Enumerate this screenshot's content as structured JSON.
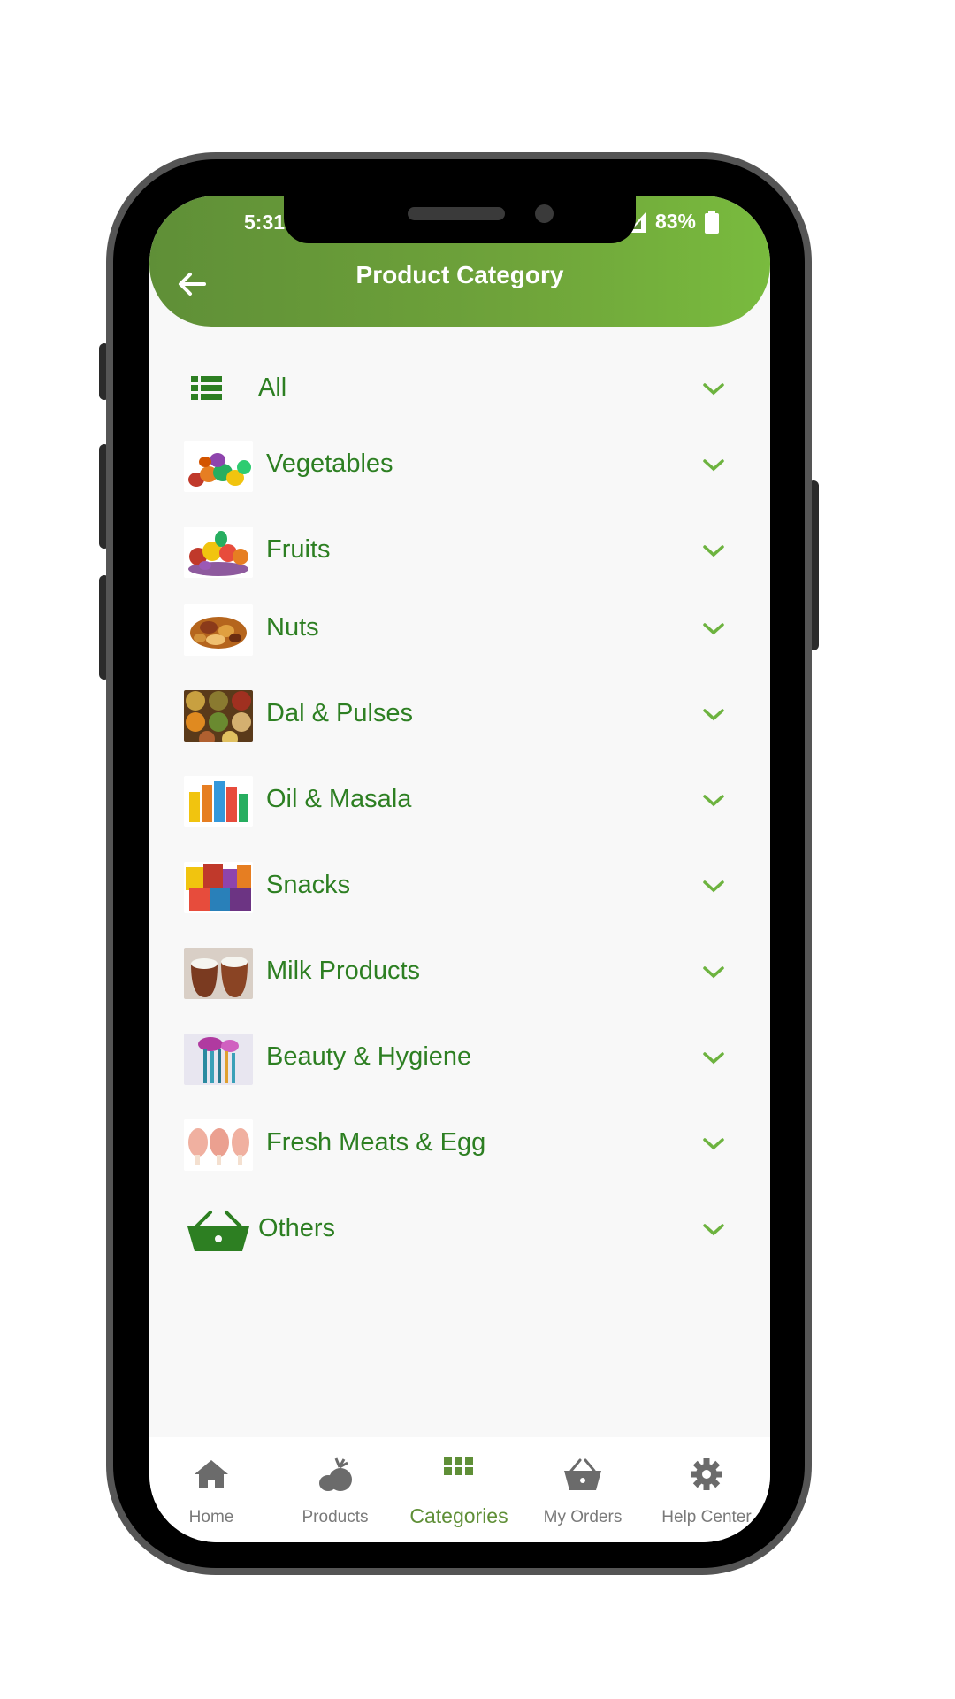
{
  "status_bar": {
    "time": "5:31",
    "battery": "83%"
  },
  "header": {
    "title": "Product Category"
  },
  "categories": [
    {
      "label": "All",
      "icon": "list-icon"
    },
    {
      "label": "Vegetables",
      "icon": "vegetables-thumbnail"
    },
    {
      "label": "Fruits",
      "icon": "fruits-thumbnail"
    },
    {
      "label": "Nuts",
      "icon": "nuts-thumbnail"
    },
    {
      "label": "Dal & Pulses",
      "icon": "dal-pulses-thumbnail"
    },
    {
      "label": "Oil & Masala",
      "icon": "oil-masala-thumbnail"
    },
    {
      "label": "Snacks",
      "icon": "snacks-thumbnail"
    },
    {
      "label": "Milk Products",
      "icon": "milk-products-thumbnail"
    },
    {
      "label": "Beauty & Hygiene",
      "icon": "beauty-hygiene-thumbnail"
    },
    {
      "label": "Fresh Meats & Egg",
      "icon": "fresh-meats-thumbnail"
    },
    {
      "label": "Others",
      "icon": "basket-icon"
    }
  ],
  "tabs": [
    {
      "label": "Home",
      "icon": "home-icon"
    },
    {
      "label": "Products",
      "icon": "fruit-icon"
    },
    {
      "label": "Categories",
      "icon": "grid-icon",
      "active": true
    },
    {
      "label": "My Orders",
      "icon": "basket-icon"
    },
    {
      "label": "Help Center",
      "icon": "gear-icon"
    }
  ],
  "colors": {
    "accent": "#2d7f22",
    "header_start": "#5f8f37",
    "header_end": "#79bb3e",
    "chevron": "#6db33f"
  }
}
